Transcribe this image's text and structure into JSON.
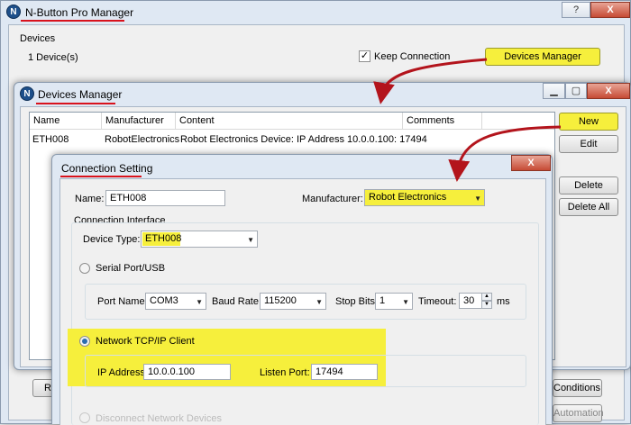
{
  "main_window": {
    "title": "N-Button Pro Manager",
    "caption_help": "?",
    "caption_close": "X",
    "devices_group_label": "Devices",
    "device_count": "1 Device(s)",
    "keep_connection_label": "Keep Connection",
    "keep_connection_checked": true,
    "devices_manager_button": "Devices Manager",
    "bottom_buttons": [
      "Re",
      "Conditions",
      "Automation"
    ]
  },
  "devices_manager": {
    "title": "Devices Manager",
    "columns": [
      "Name",
      "Manufacturer",
      "Content",
      "Comments"
    ],
    "rows": [
      {
        "name": "ETH008",
        "manufacturer": "RobotElectronics",
        "content": "Robot Electronics Device:  IP Address 10.0.0.100: 17494",
        "comments": ""
      }
    ],
    "buttons": {
      "new": "New",
      "edit": "Edit",
      "delete": "Delete",
      "delete_all": "Delete All"
    }
  },
  "connection_setting": {
    "title": "Connection Setting",
    "name_label": "Name:",
    "name_value": "ETH008",
    "manufacturer_label": "Manufacturer:",
    "manufacturer_value": "Robot Electronics",
    "interface_group_label": "Connection Interface",
    "device_type_label": "Device Type:",
    "device_type_value": "ETH008",
    "serial_label": "Serial Port/USB",
    "port_name_label": "Port Name:",
    "port_name_value": "COM3",
    "baud_rate_label": "Baud Rate:",
    "baud_rate_value": "115200",
    "stop_bits_label": "Stop Bits",
    "stop_bits_value": "1",
    "timeout_label": "Timeout:",
    "timeout_value": "30",
    "timeout_unit": "ms",
    "network_label": "Network TCP/IP Client",
    "ip_label": "IP Address:",
    "ip_value": "10.0.0.100",
    "listen_port_label": "Listen Port:",
    "listen_port_value": "17494",
    "partial_label": "Disconnect Network Devices"
  },
  "colors": {
    "highlight": "#f6ef3c",
    "annotation_red": "#d9121c",
    "window_frame": "#dfe8f3"
  }
}
